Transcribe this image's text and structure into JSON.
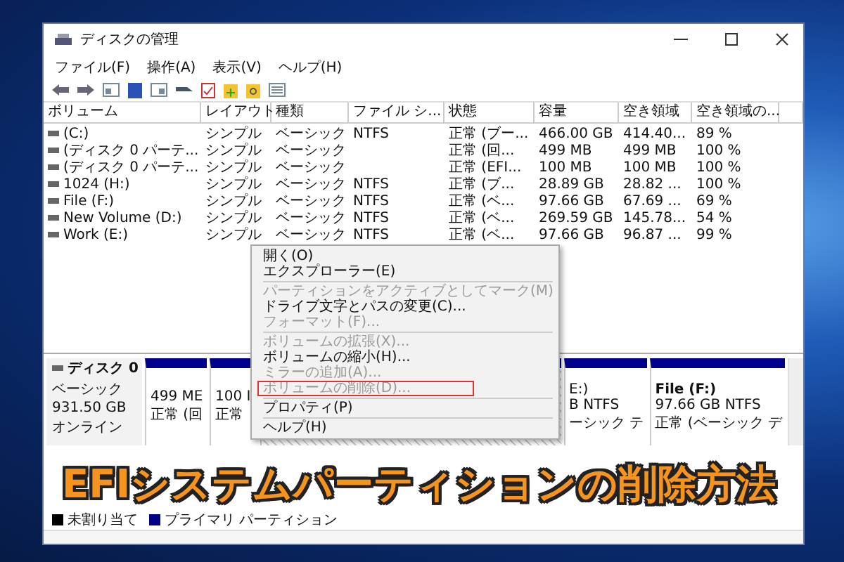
{
  "window": {
    "title": "ディスクの管理"
  },
  "menu_bar": [
    "ファイル(F)",
    "操作(A)",
    "表示(V)",
    "ヘルプ(H)"
  ],
  "table": {
    "columns": [
      "ボリューム",
      "レイアウト",
      "種類",
      "ファイル シ...",
      "状態",
      "容量",
      "空き領域",
      "空き領域の..."
    ],
    "rows": [
      [
        "(C:)",
        "シンプル",
        "ベーシック",
        "NTFS",
        "正常 (ブー...",
        "466.00 GB",
        "414.40...",
        "89 %"
      ],
      [
        "(ディスク 0 パーテ...",
        "シンプル",
        "ベーシック",
        "",
        "正常 (回...",
        "499 MB",
        "499 MB",
        "100 %"
      ],
      [
        "(ディスク 0 パーテ...",
        "シンプル",
        "ベーシック",
        "",
        "正常 (EFI...",
        "100 MB",
        "100 MB",
        "100 %"
      ],
      [
        "1024 (H:)",
        "シンプル",
        "ベーシック",
        "NTFS",
        "正常 (ブ...",
        "28.89 GB",
        "28.82 ...",
        "100 %"
      ],
      [
        "File (F:)",
        "シンプル",
        "ベーシック",
        "NTFS",
        "正常 (ベ...",
        "97.66 GB",
        "67.69 ...",
        "69 %"
      ],
      [
        "New Volume (D:)",
        "シンプル",
        "ベーシック",
        "NTFS",
        "正常 (ベ...",
        "269.59 GB",
        "145.78...",
        "54 %"
      ],
      [
        "Work (E:)",
        "シンプル",
        "ベーシック",
        "NTFS",
        "正常 (ベ...",
        "97.66 GB",
        "96.87 ...",
        "99 %"
      ]
    ]
  },
  "disk": {
    "name": "ディスク 0",
    "type": "ベーシック",
    "size": "931.50 GB",
    "status": "オンライン",
    "partitions": [
      {
        "lines": [
          "499 ME",
          "正常 (回"
        ]
      },
      {
        "lines": [
          "100 I",
          "正常"
        ]
      },
      {
        "kind": "hatched"
      },
      {
        "lines": [
          "E:)",
          "B NTFS",
          "ーシック テ"
        ]
      },
      {
        "lines": [
          "File  (F:)",
          "97.66 GB NTFS",
          "正常 (ベーシック デ"
        ]
      }
    ]
  },
  "legend": [
    {
      "label": "未割り当て",
      "color": "#000000"
    },
    {
      "label": "プライマリ パーティション",
      "color": "#00008b"
    }
  ],
  "context_menu": [
    {
      "kind": "item",
      "label": "開く(O)",
      "disabled": false,
      "outlined": false
    },
    {
      "kind": "item",
      "label": "エクスプローラー(E)",
      "disabled": false,
      "outlined": false
    },
    {
      "kind": "separator"
    },
    {
      "kind": "item",
      "label": "パーティションをアクティブとしてマーク(M)",
      "disabled": true,
      "outlined": false
    },
    {
      "kind": "item",
      "label": "ドライブ文字とパスの変更(C)...",
      "disabled": false,
      "outlined": false
    },
    {
      "kind": "item",
      "label": "フォーマット(F)...",
      "disabled": true,
      "outlined": false
    },
    {
      "kind": "separator"
    },
    {
      "kind": "item",
      "label": "ボリュームの拡張(X)...",
      "disabled": true,
      "outlined": false
    },
    {
      "kind": "item",
      "label": "ボリュームの縮小(H)...",
      "disabled": false,
      "outlined": false
    },
    {
      "kind": "item",
      "label": "ミラーの追加(A)...",
      "disabled": true,
      "outlined": false
    },
    {
      "kind": "item",
      "label": "ボリュームの削除(D)...",
      "disabled": true,
      "outlined": true
    },
    {
      "kind": "separator"
    },
    {
      "kind": "item",
      "label": "プロパティ(P)",
      "disabled": false,
      "outlined": false
    },
    {
      "kind": "separator"
    },
    {
      "kind": "item",
      "label": "ヘルプ(H)",
      "disabled": false,
      "outlined": false
    }
  ],
  "caption": "EFIシステムパーティションの削除方法"
}
